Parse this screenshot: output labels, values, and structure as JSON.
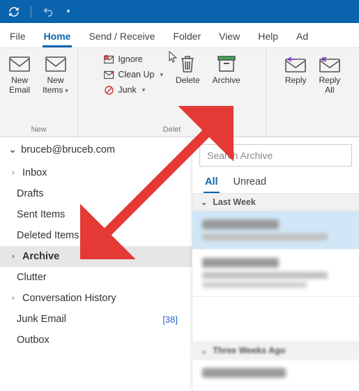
{
  "tabs": {
    "file": "File",
    "home": "Home",
    "sendrecv": "Send / Receive",
    "folder": "Folder",
    "view": "View",
    "help": "Help",
    "addins": "Ad"
  },
  "ribbon": {
    "new": {
      "email": "New\nEmail",
      "items": "New\nItems",
      "group": "New"
    },
    "delete": {
      "ignore": "Ignore",
      "cleanup": "Clean Up",
      "junk": "Junk",
      "delete": "Delete",
      "archive": "Archive",
      "group": "Delet"
    },
    "reply": {
      "reply": "Reply",
      "replyall": "Reply\nAll"
    }
  },
  "nav": {
    "account": "bruceb@bruceb.com",
    "folders": {
      "inbox": "Inbox",
      "drafts": "Drafts",
      "sent": "Sent Items",
      "deleted": "Deleted Items",
      "archive": "Archive",
      "clutter": "Clutter",
      "convhist": "Conversation History",
      "junk": "Junk Email",
      "junk_count": "[38]",
      "outbox": "Outbox"
    }
  },
  "list": {
    "search_placeholder": "Search Archive",
    "filters": {
      "all": "All",
      "unread": "Unread"
    },
    "group1": "Last Week",
    "group2": "Three Weeks Ago"
  }
}
